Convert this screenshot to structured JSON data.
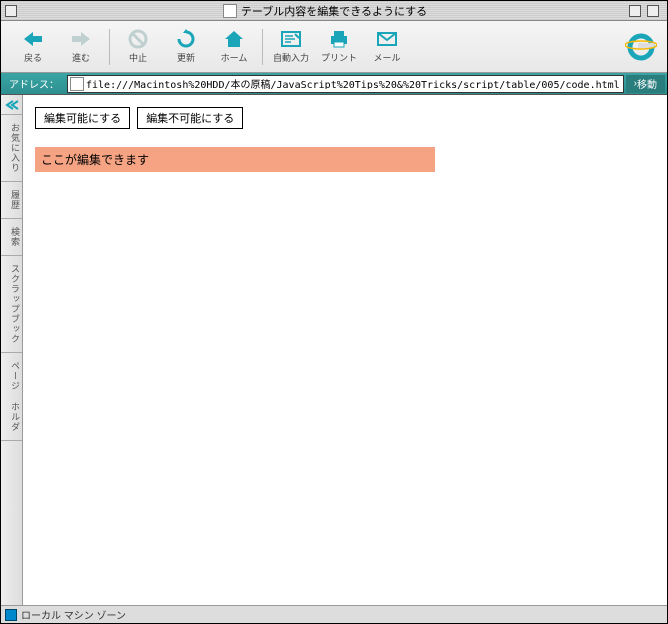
{
  "window_title": "テーブル内容を編集できるようにする",
  "toolbar": {
    "back": "戻る",
    "forward": "進む",
    "stop": "中止",
    "refresh": "更新",
    "home": "ホーム",
    "autofill": "自動入力",
    "print": "プリント",
    "mail": "メール"
  },
  "address": {
    "label": "アドレス：",
    "url": "file:///Macintosh%20HDD/本の原稿/JavaScript%20Tips%20&%20Tricks/script/table/005/code.html",
    "go": "移動"
  },
  "sidebar": {
    "tabs": [
      "お気に入り",
      "履歴",
      "検索",
      "スクラップブック",
      "ページ ホルダ"
    ]
  },
  "page": {
    "btn_enable": "編集可能にする",
    "btn_disable": "編集不可能にする",
    "editable_text": "ここが編集できます"
  },
  "status": "ローカル マシン ゾーン"
}
